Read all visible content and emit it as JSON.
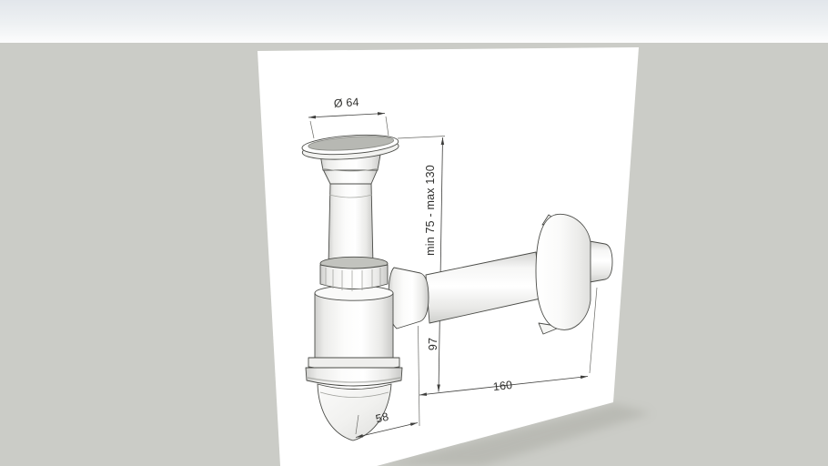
{
  "scene": {
    "colors": {
      "sky_top": "#e3e7eb",
      "sky_bottom": "#fcfdfd",
      "ground": "#cbccc7",
      "sheet": "#ffffff",
      "outline": "#4b4c48",
      "dimension_line": "#3e3e3c",
      "label_text": "#2f2f2d",
      "flange_top": "#b7b8b3",
      "nut_rim": "#c2c3be"
    }
  },
  "labels": {
    "diameter": "Ø 64",
    "adjustable_height": "min 75 - max 130",
    "trap_height": "97",
    "wall_length": "160",
    "bottom_offset": "58"
  }
}
